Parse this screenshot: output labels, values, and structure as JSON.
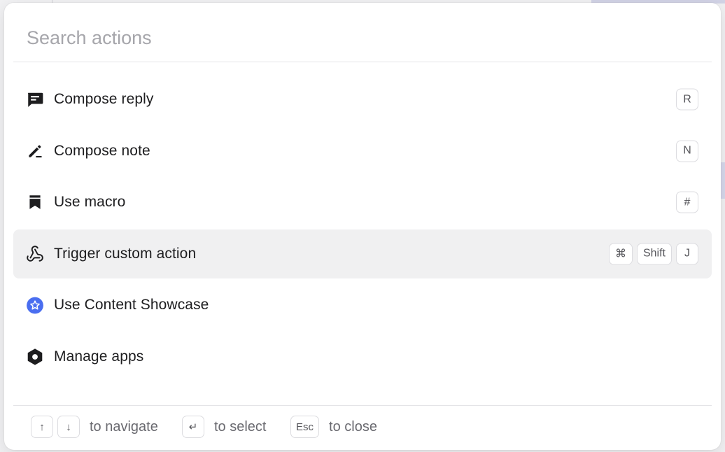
{
  "search": {
    "placeholder": "Search actions",
    "value": ""
  },
  "actions": [
    {
      "label": "Compose reply",
      "icon": "message-square-icon",
      "shortcut": [
        "R"
      ]
    },
    {
      "label": "Compose note",
      "icon": "pen-icon",
      "shortcut": [
        "N"
      ]
    },
    {
      "label": "Use macro",
      "icon": "bookmark-icon",
      "shortcut": [
        "#"
      ]
    },
    {
      "label": "Trigger custom action",
      "icon": "webhook-icon",
      "shortcut": [
        "⌘",
        "Shift",
        "J"
      ],
      "active": true
    },
    {
      "label": "Use Content Showcase",
      "icon": "star-circle-icon",
      "shortcut": []
    },
    {
      "label": "Manage apps",
      "icon": "hexagon-icon",
      "shortcut": []
    }
  ],
  "footer": {
    "navigate_keys": [
      "↑",
      "↓"
    ],
    "navigate_text": "to navigate",
    "select_key": "↵",
    "select_text": "to select",
    "close_key": "Esc",
    "close_text": "to close"
  },
  "colors": {
    "accent": "#4a6ef0",
    "active_row": "#f0f0f1",
    "icon": "#1d1d1f"
  }
}
